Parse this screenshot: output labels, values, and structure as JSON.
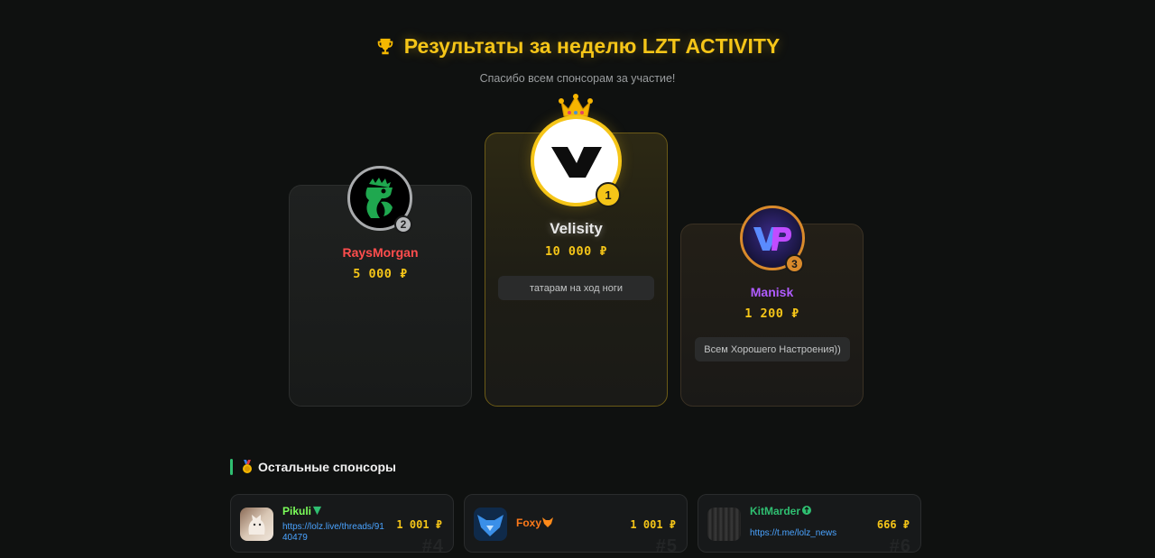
{
  "header": {
    "title": "Результаты за неделю LZT ACTIVITY",
    "subtitle": "Спасибо всем спонсорам за участие!"
  },
  "podium": {
    "first": {
      "rank": "1",
      "name": "Velisity",
      "amount": "10 000 ₽",
      "message": "татарам на ход ноги",
      "name_color": "#e8e8e8"
    },
    "second": {
      "rank": "2",
      "name": "RaysMorgan",
      "amount": "5 000 ₽",
      "name_color": "#ff4d4d"
    },
    "third": {
      "rank": "3",
      "name": "Manisk",
      "amount": "1 200 ₽",
      "message": "Всем Хорошего Настроения))",
      "name_color": "#b05cff"
    }
  },
  "others": {
    "title": "Остальные спонсоры",
    "items": [
      {
        "name": "Pikuli",
        "link": "https://lolz.live/threads/9140479",
        "amount": "1 001 ₽",
        "ghost": "#4",
        "name_color": "#7cff5a"
      },
      {
        "name": "Foxy",
        "link": "",
        "amount": "1 001 ₽",
        "ghost": "#5",
        "name_color": "#ff7a1a"
      },
      {
        "name": "KitMarder",
        "link": "https://t.me/lolz_news",
        "amount": "666 ₽",
        "ghost": "#6",
        "name_color": "#2fbf71"
      }
    ]
  },
  "colors": {
    "accent": "#f5c518",
    "section_accent": "#2fbf71",
    "link": "#4aa3ff"
  }
}
